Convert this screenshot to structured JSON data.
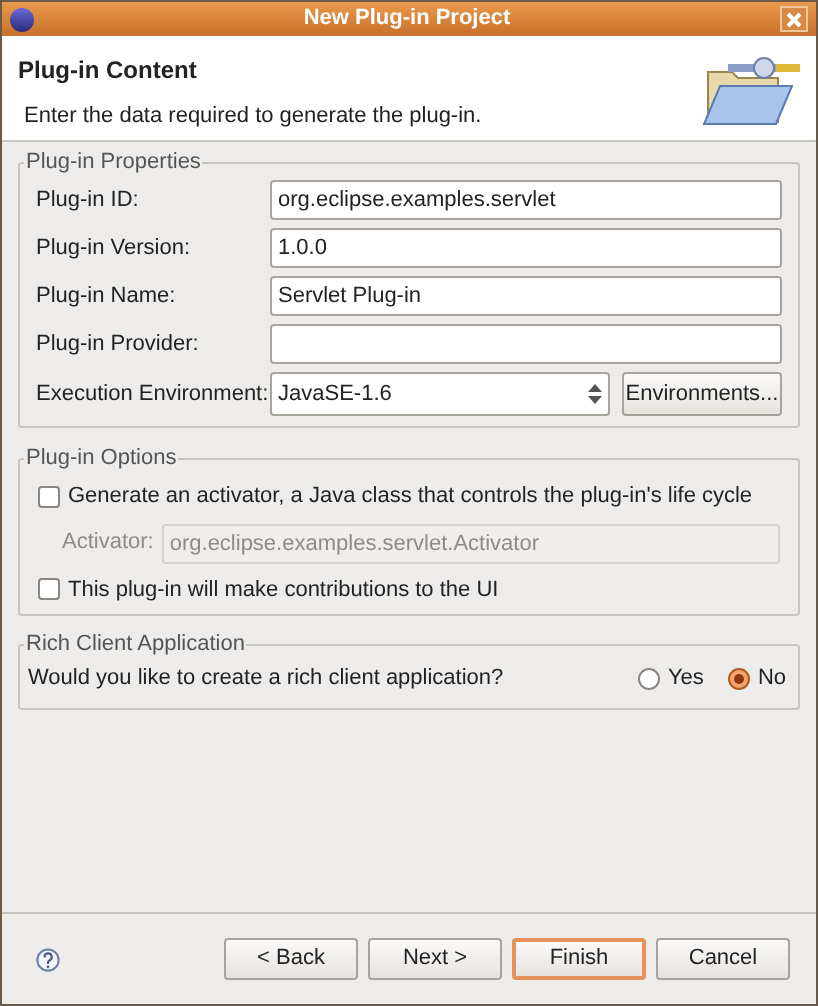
{
  "window": {
    "title": "New Plug-in Project"
  },
  "header": {
    "title": "Plug-in Content",
    "description": "Enter the data required to generate the plug-in."
  },
  "properties": {
    "title": "Plug-in Properties",
    "fields": [
      {
        "label": "Plug-in ID:",
        "value": "org.eclipse.examples.servlet"
      },
      {
        "label": "Plug-in Version:",
        "value": "1.0.0"
      },
      {
        "label": "Plug-in Name:",
        "value": "Servlet Plug-in"
      },
      {
        "label": "Plug-in Provider:"
      }
    ],
    "environment": {
      "label": "Execution Environment:",
      "value": "JavaSE-1.6",
      "button": "Environments..."
    }
  },
  "options": {
    "title": "Plug-in Options",
    "generate_activator": {
      "label": "Generate an activator, a Java class that controls the plug-in's life cycle",
      "checked": false
    },
    "activator": {
      "label": "Activator:",
      "value": "org.eclipse.examples.servlet.Activator",
      "disabled": true
    },
    "ui_contributions": {
      "label": "This plug-in will make contributions to the UI",
      "checked": false
    }
  },
  "rcp": {
    "title": "Rich Client Application",
    "question": "Would you like to create a rich client application?",
    "choices": [
      {
        "label": "Yes",
        "selected": false
      },
      {
        "label": "No",
        "selected": true
      }
    ]
  },
  "buttons": [
    {
      "label": "< Back",
      "default": false
    },
    {
      "label": "Next >",
      "default": false
    },
    {
      "label": "Finish",
      "default": true
    },
    {
      "label": "Cancel",
      "default": false
    }
  ]
}
